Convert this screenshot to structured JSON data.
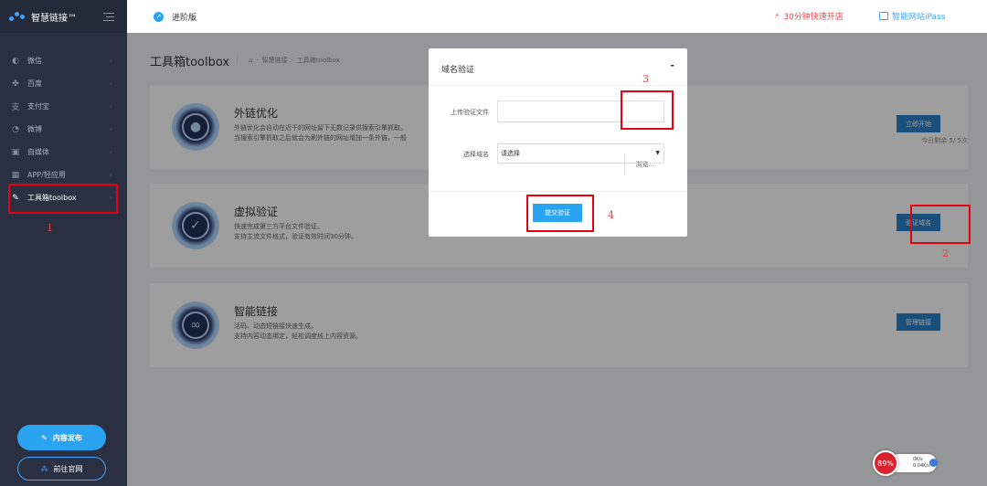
{
  "brand": {
    "name": "智慧链接™"
  },
  "sidebar": {
    "items": [
      {
        "label": "微信",
        "icon": "wechat-icon"
      },
      {
        "label": "百度",
        "icon": "baidu-icon"
      },
      {
        "label": "支付宝",
        "icon": "alipay-icon"
      },
      {
        "label": "微博",
        "icon": "weibo-icon"
      },
      {
        "label": "自媒体",
        "icon": "media-icon"
      },
      {
        "label": "APP/轻应用",
        "icon": "app-icon"
      },
      {
        "label": "工具箱toolbox",
        "icon": "wrench-icon",
        "active": true
      }
    ],
    "publish_label": "内容发布",
    "site_label": "前往官网"
  },
  "header": {
    "version_label": "进阶版",
    "link_quick": "30分钟快速开店",
    "link_ipass": "智能网站iPass"
  },
  "main": {
    "title": "工具箱toolbox",
    "breadcrumb": [
      "智慧链接",
      "工具箱toolbox"
    ],
    "cards": [
      {
        "title": "外链优化",
        "desc1": "外链优化会自动在近千的网址留下无数记录供搜索引擎抓取。",
        "desc2": "当搜索引擎抓取之后就会为刷外链的网址增加一条外链，一般",
        "button": "立即开始",
        "note": "今日剩余 5/ 5次"
      },
      {
        "title": "虚拟验证",
        "desc1": "快速完成第三方平台文件验证。",
        "desc2": "支持主流文件格式，验证有效时间30分钟。",
        "button": "验证域名"
      },
      {
        "title": "智能链接",
        "desc1": "活码、动态短链接快速生成。",
        "desc2": "支持内容动态绑定，轻松调度线上内容资源。",
        "button": "管理链接"
      }
    ]
  },
  "modal": {
    "title": "域名验证",
    "close": "-",
    "upload_label": "上传验证文件",
    "browse_label": "浏览...",
    "domain_label": "选择域名",
    "select_value": "请选择",
    "submit_label": "提交验证"
  },
  "annotations": [
    "1",
    "2",
    "3",
    "4"
  ],
  "speed": {
    "percent": "89%",
    "up": "0K/s",
    "down": "0.04K/s"
  },
  "colors": {
    "accent": "#2aa3f1",
    "sidebar": "#2a3042",
    "highlight": "#e60012",
    "link_red": "#f5444b"
  }
}
